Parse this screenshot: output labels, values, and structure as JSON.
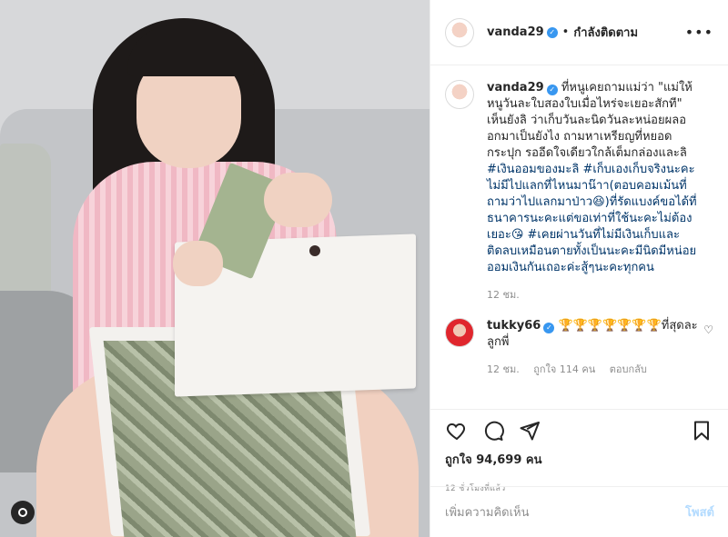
{
  "header": {
    "username": "vanda29",
    "separator": "•",
    "follow_label": "กำลังติดตาม",
    "more": "•••"
  },
  "caption": {
    "username": "vanda29",
    "text": "ที่หนูเคยถามแม่ว่า \"แม่ให้หนูวันละใบสองใบเมื่อไหร่จะเยอะสักที\" เห็นยังลิ ว่าเก็บวันละนิดวันละหน่อยผลออกมาเป็นยังไง ถามหาเหรียญที่หยอดกระปุก รออีดใจเดียวใกล้เต็มกล่องและลิ",
    "tags": "#เงินออมของมะลิ #เก็บเองเก็บจริงนะคะไม่มีไปแลกที่ไหนมาน๊าา(ตอบคอมเม้นที่ถามว่าไปแลกมาป่าว😆)ที่รัดแบงค์ขอได้ที่ธนาคารนะคะแต่ขอเท่าที่ใช้นะคะไม่ต้องเยอะ😘 #เคยผ่านวันที่ไม่มีเงินเก็บและติดลบเหมือนตายทั้งเป็นนะคะมีนิดมีหน่อยออมเงินกันเถอะค่ะสู้ๆนะคะทุกคน",
    "time": "12 ชม."
  },
  "comment": {
    "username": "tukky66",
    "text": "🏆🏆🏆🏆🏆🏆🏆ที่สุดละลูกพี่",
    "time": "12 ชม.",
    "likes": "ถูกใจ 114 คน",
    "reply": "ตอบกลับ"
  },
  "actions": {
    "likes": "ถูกใจ 94,699 คน",
    "timestamp": "12 ชั่วโมงที่แล้ว"
  },
  "add_comment": {
    "placeholder": "เพิ่มความคิดเห็น",
    "post_label": "โพสต์"
  },
  "colors": {
    "verified": "#3897f0",
    "hashtag": "#003569",
    "muted": "#8e8e8e",
    "post_disabled": "#b3dbff"
  }
}
